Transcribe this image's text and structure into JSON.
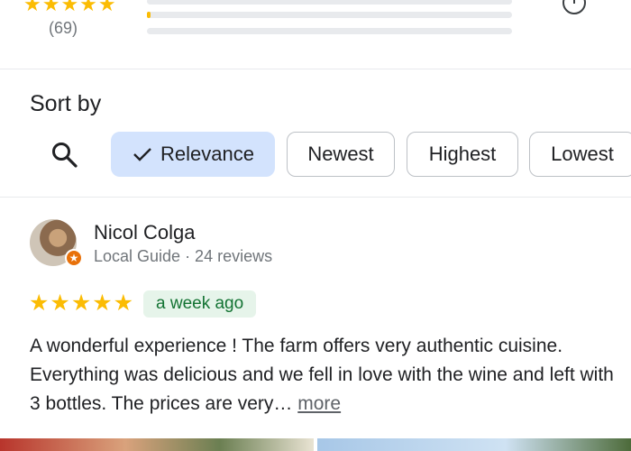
{
  "summary": {
    "stars": "★★★★★",
    "count": "(69)",
    "bars": [
      {
        "fraction": 0.0
      },
      {
        "fraction": 0.01
      },
      {
        "fraction": 0.0
      }
    ]
  },
  "sort": {
    "label": "Sort by",
    "search_icon": "search-icon",
    "chips": [
      {
        "label": "Relevance",
        "selected": true
      },
      {
        "label": "Newest",
        "selected": false
      },
      {
        "label": "Highest",
        "selected": false
      },
      {
        "label": "Lowest",
        "selected": false
      }
    ]
  },
  "review": {
    "name": "Nicol Colga",
    "meta": "Local Guide · 24 reviews",
    "stars": "★★★★★",
    "date": "a week ago",
    "text": "A wonderful experience ! The farm offers very authentic cuisine. Everything was delicious and we fell in love with the wine and left with 3 bottles. The prices are very…",
    "more": "more"
  },
  "colors": {
    "accent_chip": "#d3e3fd",
    "star": "#fbbc04",
    "date_bg": "#e6f4ea",
    "date_text": "#137333"
  }
}
